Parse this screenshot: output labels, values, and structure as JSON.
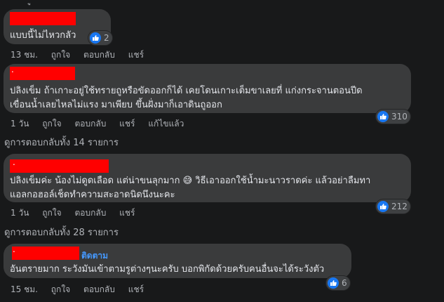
{
  "colors": {
    "background": "#18191a",
    "bubble": "#3a3b3c",
    "text": "#e4e6eb",
    "meta": "#b0b3b8",
    "like_blue": "#1877f2",
    "follow_blue": "#4599ff",
    "redaction": "#ff0000"
  },
  "top_fragment": "ู",
  "comments": [
    {
      "text_lines": [
        "แบบนี้ไม่ไหวกลัว"
      ],
      "reaction_icon": "thumbs-up-icon",
      "reaction_count": "2",
      "actions": [
        "13 ชม.",
        "ถูกใจ",
        "ตอบกลับ",
        "แชร์"
      ]
    },
    {
      "name_fragment": ".",
      "text_lines": [
        "ปลิงเข็ม ถ้าเกาะอยู่ใช้ทรายถูหรือขัดออกก็ได้ เคยโดนเกาะเต็มขาเลยที่ แก่งกระจานตอนปีด",
        "เขื่อนน้ำเลยไหลไม่แรง มาเพียบ ขึ้นฝั่งมาก็เอาดินถูออก"
      ],
      "reaction_icon": "thumbs-up-icon",
      "reaction_count": "310",
      "actions": [
        "1 วัน",
        "ถูกใจ",
        "ตอบกลับ",
        "แชร์",
        "แก้ไขแล้ว"
      ],
      "replies_label": "ดูการตอบกลับทั้ง 14 รายการ"
    },
    {
      "name_fragment": ".",
      "text_lines": [
        "ปลิงเข็มค่ะ น้องไม่ดูดเลือด แต่น่าขนลุกมาก 😅 วิธีเอาออกใช้น้ำมะนาวราดค่ะ แล้วอย่าลืมทา",
        "แอลกอฮอล์เช็ดทำความสะอาดนิดนึงนะคะ"
      ],
      "reaction_icon": "thumbs-up-icon",
      "reaction_count": "212",
      "actions": [
        "1 วัน",
        "ถูกใจ",
        "ตอบกลับ",
        "แชร์"
      ],
      "replies_label": "ดูการตอบกลับทั้ง 28 รายการ"
    },
    {
      "name_fragment": ".",
      "follow_label": "ติดตาม",
      "text_lines": [
        "อันตรายมาก ระวังมันเข้าตามรูต่างๆนะครับ บอกพิกัดด้วยครับคนอื่นจะได้ระวังตัว"
      ],
      "reaction_icon": "thumbs-up-icon",
      "reaction_count": "6",
      "actions": [
        "15 ชม.",
        "ถูกใจ",
        "ตอบกลับ",
        "แชร์"
      ]
    }
  ]
}
